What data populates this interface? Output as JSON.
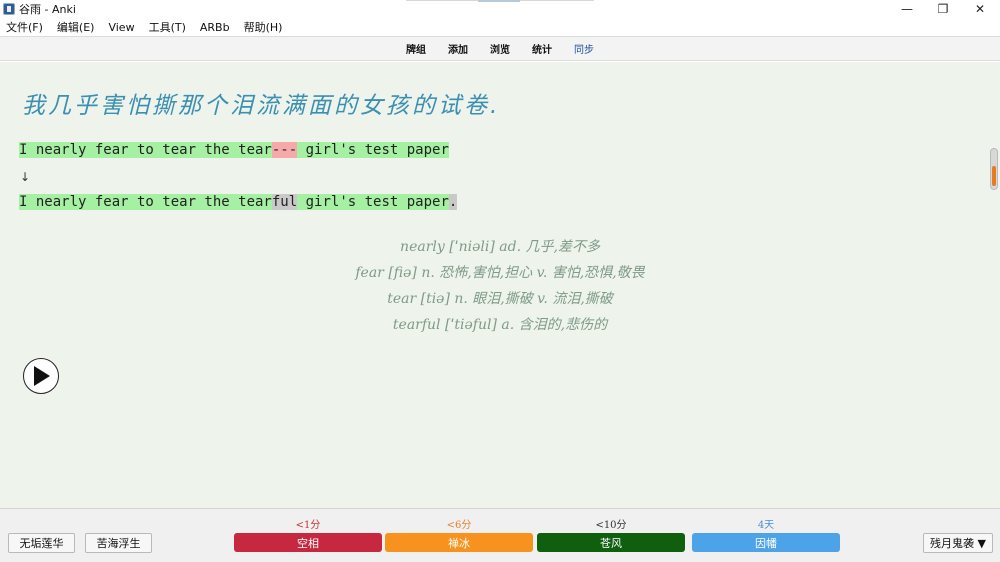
{
  "window": {
    "title": "谷雨 - Anki",
    "controls": {
      "minimize": "—",
      "restore": "❐",
      "close": "✕"
    }
  },
  "menu": {
    "items": [
      "文件(F)",
      "编辑(E)",
      "View",
      "工具(T)",
      "ARBb",
      "帮助(H)"
    ]
  },
  "toolbar": {
    "items": [
      "牌组",
      "添加",
      "浏览",
      "统计",
      "同步"
    ]
  },
  "card": {
    "question": "我几乎害怕撕那个泪流满面的女孩的试卷.",
    "typed": {
      "prefix": "I nearly fear to tear the tear",
      "wrong": "---",
      "suffix": " girl's test paper"
    },
    "arrow": "↓",
    "correct": {
      "prefix": "I nearly fear to tear the tear",
      "missed": "ful",
      "middle": " girl's test paper",
      "missed_end": "."
    },
    "notes": [
      "nearly [ˈniəli] ad. 几乎,差不多",
      "fear [fiə] n. 恐怖,害怕,担心 v. 害怕,恐惧,敬畏",
      "tear [tiə] n. 眼泪,撕破 v. 流泪,撕破",
      "tearful [ˈtiəful] a. 含泪的,悲伤的"
    ],
    "play_icon": "play-icon"
  },
  "bottom": {
    "left_buttons": [
      "无垢莲华",
      "苦海浮生"
    ],
    "ease": [
      {
        "interval": "<1分",
        "label": "空相",
        "color": "#c6283f",
        "label_color": "#cc3333"
      },
      {
        "interval": "<6分",
        "label": "禅冰",
        "color": "#f7921e",
        "label_color": "#e9822b"
      },
      {
        "interval": "<10分",
        "label": "苍风",
        "color": "#0f5f0f",
        "label_color": "#333333"
      },
      {
        "interval": "4天",
        "label": "因幡",
        "color": "#4da3e8",
        "label_color": "#4d8fd6"
      }
    ],
    "right_button": "残月鬼袭 ▼"
  }
}
